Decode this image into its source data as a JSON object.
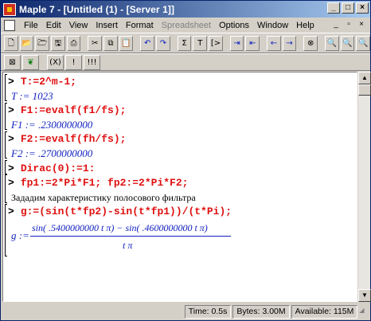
{
  "window": {
    "title": "Maple 7 - [Untitled (1) - [Server 1]]",
    "controls": [
      "_",
      "□",
      "×"
    ]
  },
  "menubar": {
    "items": [
      {
        "label": "File",
        "disabled": false
      },
      {
        "label": "Edit",
        "disabled": false
      },
      {
        "label": "View",
        "disabled": false
      },
      {
        "label": "Insert",
        "disabled": false
      },
      {
        "label": "Format",
        "disabled": false
      },
      {
        "label": "Spreadsheet",
        "disabled": true
      },
      {
        "label": "Options",
        "disabled": false
      },
      {
        "label": "Window",
        "disabled": false
      },
      {
        "label": "Help",
        "disabled": false
      }
    ],
    "doc_controls": [
      "_",
      "▫",
      "×"
    ]
  },
  "toolbar1": [
    {
      "name": "new-icon",
      "glyph": "🗋"
    },
    {
      "name": "open-icon",
      "glyph": "📂"
    },
    {
      "name": "open-url-icon",
      "glyph": "🗁"
    },
    {
      "name": "save-icon",
      "glyph": "🖫"
    },
    {
      "name": "print-icon",
      "glyph": "⎙"
    },
    {
      "name": "sep"
    },
    {
      "name": "cut-icon",
      "glyph": "✂"
    },
    {
      "name": "copy-icon",
      "glyph": "⧉"
    },
    {
      "name": "paste-icon",
      "glyph": "📋"
    },
    {
      "name": "sep"
    },
    {
      "name": "undo-icon",
      "glyph": "↶"
    },
    {
      "name": "redo-icon",
      "glyph": "↷"
    },
    {
      "name": "sep"
    },
    {
      "name": "insert-math-icon",
      "glyph": "Σ"
    },
    {
      "name": "insert-text-icon",
      "glyph": "T"
    },
    {
      "name": "insert-prompt-icon",
      "glyph": "[>"
    },
    {
      "name": "sep"
    },
    {
      "name": "indent-icon",
      "glyph": "⇥"
    },
    {
      "name": "outdent-icon",
      "glyph": "⇤"
    },
    {
      "name": "sep"
    },
    {
      "name": "back-icon",
      "glyph": "←"
    },
    {
      "name": "forward-icon",
      "glyph": "→"
    },
    {
      "name": "sep"
    },
    {
      "name": "stop-icon",
      "glyph": "⊗"
    },
    {
      "name": "sep"
    },
    {
      "name": "zoom-in-icon",
      "glyph": "🔍"
    },
    {
      "name": "zoom-out-icon",
      "glyph": "🔍"
    },
    {
      "name": "zoom-fit-icon",
      "glyph": "🔍"
    }
  ],
  "toolbar2": [
    {
      "name": "text-mode-icon",
      "glyph": "⊠"
    },
    {
      "name": "maple-leaf-icon",
      "glyph": "❦"
    },
    {
      "name": "sep"
    },
    {
      "name": "standard-math-icon",
      "glyph": "(X)"
    },
    {
      "name": "execute-icon",
      "glyph": "!"
    },
    {
      "name": "execute-all-icon",
      "glyph": "!!!"
    }
  ],
  "worksheet": {
    "prompt_symbol": ">",
    "lines": [
      {
        "kind": "input",
        "text": "T:=2^m-1;"
      },
      {
        "kind": "output",
        "text": "T := 1023"
      },
      {
        "kind": "input",
        "text": "F1:=evalf(f1/fs);"
      },
      {
        "kind": "output",
        "text": "F1 := .2300000000"
      },
      {
        "kind": "input",
        "text": "F2:=evalf(fh/fs);"
      },
      {
        "kind": "output",
        "text": "F2 := .2700000000"
      },
      {
        "kind": "input",
        "text": "Dirac(0):=1:"
      },
      {
        "kind": "input",
        "text": "fp1:=2*Pi*F1; fp2:=2*Pi*F2;"
      },
      {
        "kind": "text",
        "text": "Зададим характеристику полосового фильтра"
      },
      {
        "kind": "input",
        "text": "g:=(sin(t*fp2)-sin(t*fp1))/(t*Pi);"
      }
    ],
    "final_output": {
      "lhs": "g :=",
      "numerator": "sin( .5400000000 t π) − sin( .4600000000 t π)",
      "denominator": "t π"
    }
  },
  "statusbar": {
    "time": "Time: 0.5s",
    "bytes": "Bytes: 3.00M",
    "available": "Available: 115M"
  }
}
